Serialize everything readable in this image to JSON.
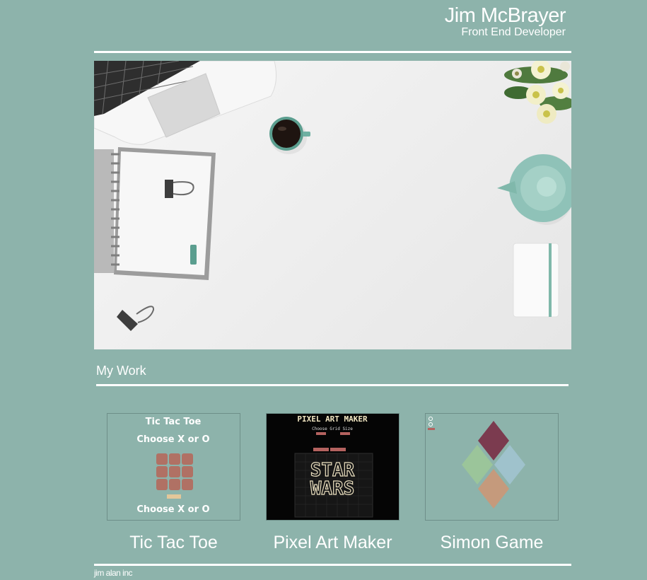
{
  "header": {
    "name": "Jim McBrayer",
    "title": "Front End Developer"
  },
  "hero": {
    "image": "desk-workspace-photo"
  },
  "work": {
    "section_title": "My Work",
    "projects": [
      {
        "name": "Tic Tac Toe",
        "thumbnail": {
          "heading": "Tic Tac Toe",
          "subheading": "Choose X or O",
          "footer_text": "Choose X or O"
        }
      },
      {
        "name": "Pixel Art Maker",
        "thumbnail": {
          "heading": "PIXEL ART MAKER",
          "subheading": "Choose Grid Size",
          "art_text_line1": "STAR",
          "art_text_line2": "WARS"
        }
      },
      {
        "name": "Simon Game"
      }
    ]
  },
  "footer": {
    "text": "jim alan inc"
  },
  "colors": {
    "background": "#8db3ab",
    "text": "#ffffff",
    "ttt_tile": "#b07164",
    "simon_red": "#7b3b4f",
    "simon_green": "#9bc59a",
    "simon_blue": "#9fc2cc",
    "simon_orange": "#c59a7c"
  }
}
